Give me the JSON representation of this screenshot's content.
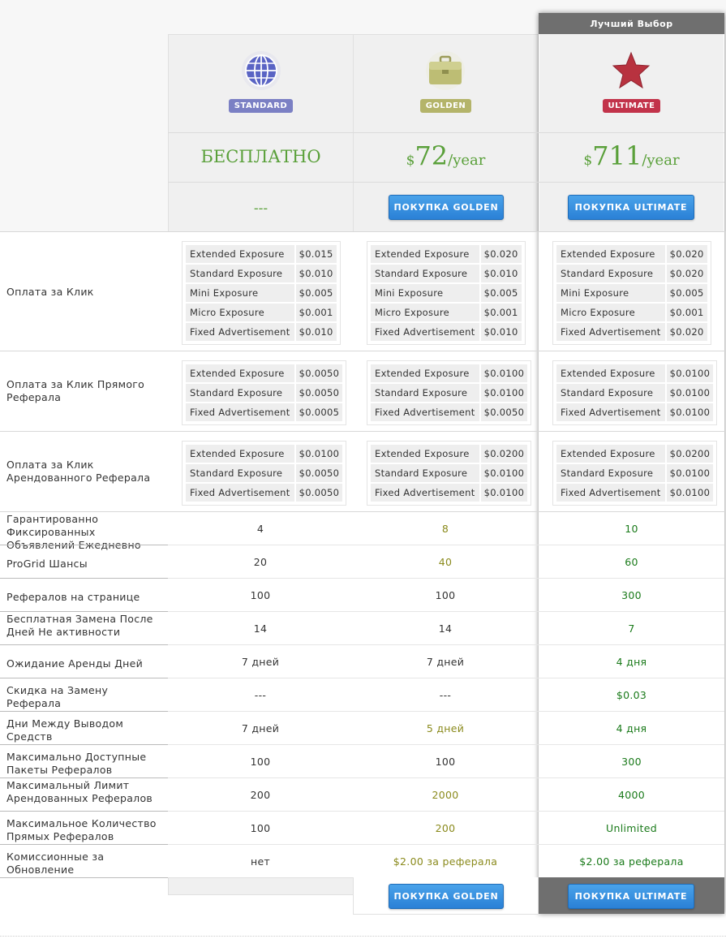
{
  "best_choice": "Лучший Выбор",
  "plans": [
    {
      "badge": "STANDARD",
      "price": "БЕСПЛАТНО",
      "action": "---",
      "icon": "globe-icon"
    },
    {
      "badge": "GOLDEN",
      "price_currency": "$",
      "price_amount": "72",
      "price_period": "/year",
      "buy": "ПОКУПКА GOLDEN",
      "icon": "briefcase-icon"
    },
    {
      "badge": "ULTIMATE",
      "price_currency": "$",
      "price_amount": "711",
      "price_period": "/year",
      "buy": "ПОКУПКА ULTIMATE",
      "icon": "star-icon"
    }
  ],
  "colors": {
    "standard": "#7b80c4",
    "golden": "#b4b46a",
    "ultimate": "#c2334a",
    "button": "#3390e0",
    "green": "#1a7a1a",
    "olive": "#8a8a1c"
  },
  "table_sections": [
    {
      "label": "Оплата за Клик",
      "rows": [
        [
          "Extended Exposure",
          "$0.015",
          "$0.020",
          "$0.020"
        ],
        [
          "Standard Exposure",
          "$0.010",
          "$0.010",
          "$0.020"
        ],
        [
          "Mini Exposure",
          "$0.005",
          "$0.005",
          "$0.005"
        ],
        [
          "Micro Exposure",
          "$0.001",
          "$0.001",
          "$0.001"
        ],
        [
          "Fixed Advertisement",
          "$0.010",
          "$0.010",
          "$0.020"
        ]
      ]
    },
    {
      "label": "Оплата за Клик Прямого Реферала",
      "rows": [
        [
          "Extended Exposure",
          "$0.0050",
          "$0.0100",
          "$0.0100"
        ],
        [
          "Standard Exposure",
          "$0.0050",
          "$0.0100",
          "$0.0100"
        ],
        [
          "Fixed Advertisement",
          "$0.0005",
          "$0.0050",
          "$0.0100"
        ]
      ]
    },
    {
      "label": "Оплата за Клик Арендованного Реферала",
      "rows": [
        [
          "Extended Exposure",
          "$0.0100",
          "$0.0200",
          "$0.0200"
        ],
        [
          "Standard Exposure",
          "$0.0050",
          "$0.0100",
          "$0.0100"
        ],
        [
          "Fixed Advertisement",
          "$0.0050",
          "$0.0100",
          "$0.0100"
        ]
      ]
    }
  ],
  "features": [
    {
      "label": "Гарантированно Фиксированных Объявлений Ежедневно",
      "values": [
        "4",
        "8",
        "10"
      ]
    },
    {
      "label": "ProGrid Шансы",
      "values": [
        "20",
        "40",
        "60"
      ]
    },
    {
      "label": "Рефералов на странице",
      "values": [
        "100",
        "100",
        "300"
      ]
    },
    {
      "label": "Бесплатная Замена После Дней Не активности",
      "values": [
        "14",
        "14",
        "7"
      ]
    },
    {
      "label": "Ожидание Аренды Дней",
      "values": [
        "7 дней",
        "7 дней",
        "4 дня"
      ]
    },
    {
      "label": "Скидка на Замену Реферала",
      "values": [
        "---",
        "---",
        "$0.03"
      ]
    },
    {
      "label": "Дни Между Выводом Средств",
      "values": [
        "7 дней",
        "5 дней",
        "4 дня"
      ]
    },
    {
      "label": "Максимально Доступные Пакеты Рефералов",
      "values": [
        "100",
        "100",
        "300"
      ]
    },
    {
      "label": "Максимальный Лимит Арендованных Рефералов",
      "values": [
        "200",
        "2000",
        "4000"
      ]
    },
    {
      "label": "Максимальное Количество Прямых Рефералов",
      "values": [
        "100",
        "200",
        "Unlimited"
      ]
    },
    {
      "label": "Комиссионные за Обновление",
      "values": [
        "нет",
        "$2.00 за реферала",
        "$2.00 за реферала"
      ]
    }
  ]
}
